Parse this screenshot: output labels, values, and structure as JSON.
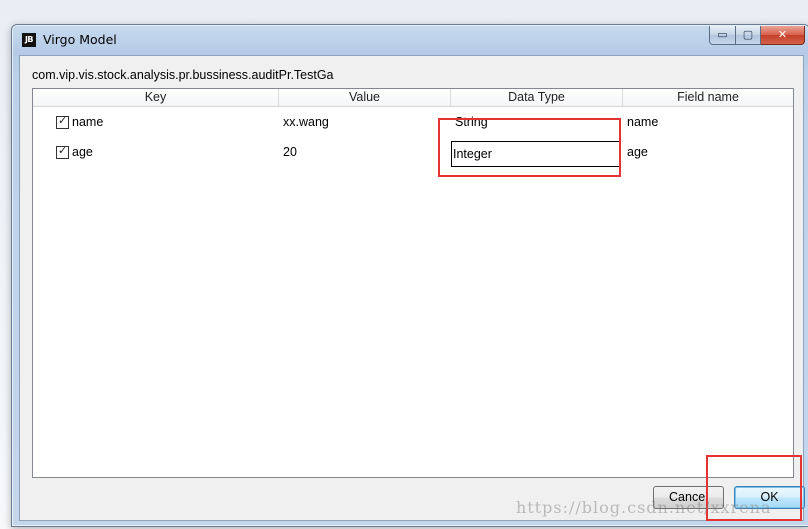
{
  "window": {
    "app_icon_text": "JB",
    "title": "Virgo Model",
    "caption": {
      "minimize": "▭",
      "maximize": "▢",
      "close": "✕"
    }
  },
  "class_path": "com.vip.vis.stock.analysis.pr.bussiness.auditPr.TestGa",
  "table": {
    "columns": [
      "Key",
      "Value",
      "Data Type",
      "Field name"
    ],
    "rows": [
      {
        "checked": true,
        "key": "name",
        "value": "xx.wang",
        "data_type": "String",
        "field_name": "name"
      },
      {
        "checked": true,
        "key": "age",
        "value": "20",
        "data_type": "Integer",
        "field_name": "age"
      }
    ],
    "editing_cell_value": "Integer"
  },
  "buttons": {
    "cancel": "Cancel",
    "ok": "OK"
  },
  "annotation_color": "#e53333",
  "watermark": "https://blog.csdn.net/xxrena"
}
